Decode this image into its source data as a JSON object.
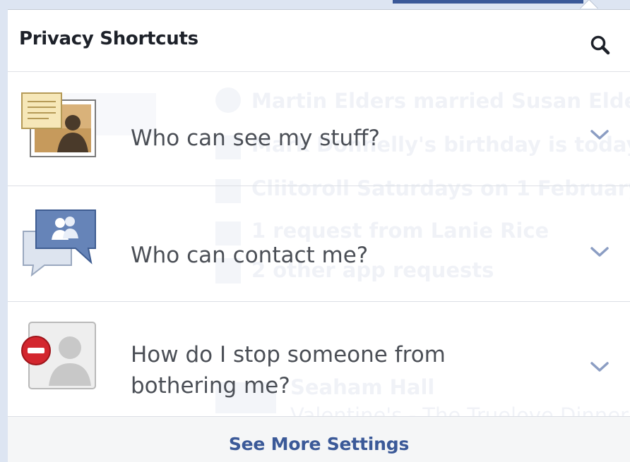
{
  "panel": {
    "title": "Privacy Shortcuts",
    "search_icon": "search-icon"
  },
  "rows": [
    {
      "label": "Who can see my stuff?",
      "icon": "photo-document-icon",
      "chevron": "chevron-down-icon"
    },
    {
      "label": "Who can contact me?",
      "icon": "chat-people-icon",
      "chevron": "chevron-down-icon"
    },
    {
      "label": "How do I stop someone from bothering me?",
      "icon": "block-person-icon",
      "chevron": "chevron-down-icon"
    }
  ],
  "footer": {
    "link": "See More Settings"
  },
  "colors": {
    "link": "#3b5998",
    "title": "#1d2129",
    "label": "#4b4f56",
    "footer_bg": "#f5f6f7",
    "page_bg": "#dde5f2"
  }
}
